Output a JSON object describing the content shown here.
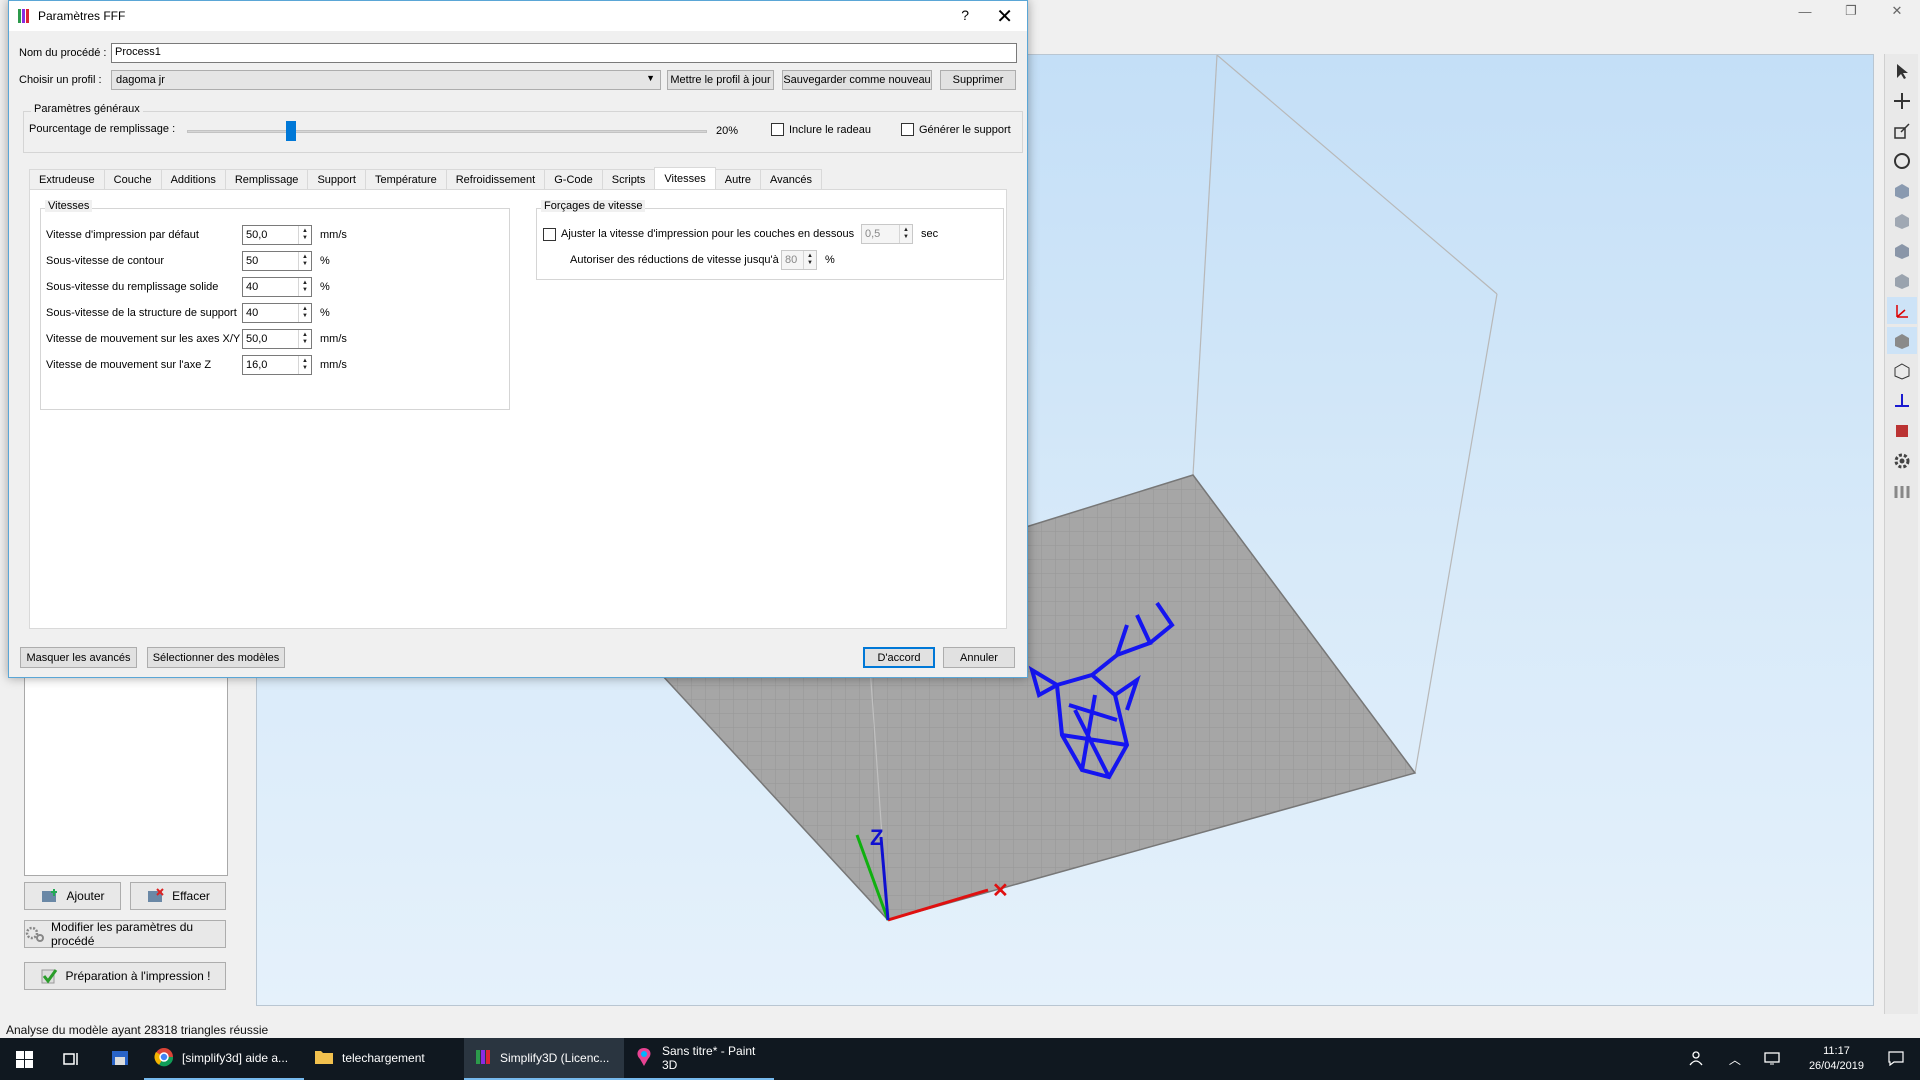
{
  "app": {
    "status_text": "Analyse du modèle ayant 28318 triangles réussie",
    "side": {
      "add_label": "Ajouter",
      "clear_label": "Effacer",
      "edit_process_label": "Modifier les paramètres du procédé",
      "prepare_label": "Préparation à l'impression !"
    },
    "axis_z_label": "Z"
  },
  "dialog": {
    "title": "Paramètres FFF",
    "help_glyph": "?",
    "close_glyph": "✕",
    "process_name_label": "Nom du procédé :",
    "process_name_value": "Process1",
    "profile_label": "Choisir un profil :",
    "profile_value": "dagoma jr",
    "update_profile_label": "Mettre le profil à jour",
    "save_new_label": "Sauvegarder comme nouveau",
    "delete_label": "Supprimer",
    "general_title": "Paramètres généraux",
    "infill_label": "Pourcentage de remplissage :",
    "infill_percent": 20,
    "infill_value_text": "20%",
    "raft_label": "Inclure le radeau",
    "support_label": "Générer le support",
    "tabs": [
      {
        "label": "Extrudeuse",
        "active": false
      },
      {
        "label": "Couche",
        "active": false
      },
      {
        "label": "Additions",
        "active": false
      },
      {
        "label": "Remplissage",
        "active": false
      },
      {
        "label": "Support",
        "active": false
      },
      {
        "label": "Température",
        "active": false
      },
      {
        "label": "Refroidissement",
        "active": false
      },
      {
        "label": "G-Code",
        "active": false
      },
      {
        "label": "Scripts",
        "active": false
      },
      {
        "label": "Vitesses",
        "active": true
      },
      {
        "label": "Autre",
        "active": false
      },
      {
        "label": "Avancés",
        "active": false
      }
    ],
    "speeds_group_title": "Vitesses",
    "speeds": [
      {
        "label": "Vitesse d'impression par défaut",
        "value": "50,0",
        "unit": "mm/s"
      },
      {
        "label": "Sous-vitesse de contour",
        "value": "50",
        "unit": "%"
      },
      {
        "label": "Sous-vitesse du remplissage solide",
        "value": "40",
        "unit": "%"
      },
      {
        "label": "Sous-vitesse de la structure de support",
        "value": "40",
        "unit": "%"
      },
      {
        "label": "Vitesse de mouvement sur les axes X/Y",
        "value": "50,0",
        "unit": "mm/s"
      },
      {
        "label": "Vitesse de mouvement sur l'axe Z",
        "value": "16,0",
        "unit": "mm/s"
      }
    ],
    "overrides_group_title": "Forçages de vitesse",
    "adjust_label": "Ajuster la vitesse d'impression pour les couches en dessous",
    "adjust_value": "0,5",
    "adjust_unit": "sec",
    "allow_label": "Autoriser des réductions de vitesse jusqu'à",
    "allow_value": "80",
    "allow_unit": "%",
    "hide_advanced_label": "Masquer les avancés",
    "select_models_label": "Sélectionner des modèles",
    "ok_label": "D'accord",
    "cancel_label": "Annuler"
  },
  "taskbar": {
    "apps": [
      {
        "label": "[simplify3d] aide a...",
        "icon": "chrome-icon",
        "state": "open"
      },
      {
        "label": "telechargement",
        "icon": "folder-icon",
        "state": "none"
      },
      {
        "label": "Simplify3D (Licenc...",
        "icon": "simplify3d-icon",
        "state": "active"
      },
      {
        "label": "Sans titre* - Paint 3D",
        "icon": "paint3d-icon",
        "state": "open"
      }
    ],
    "time": "11:17",
    "date": "26/04/2019"
  }
}
